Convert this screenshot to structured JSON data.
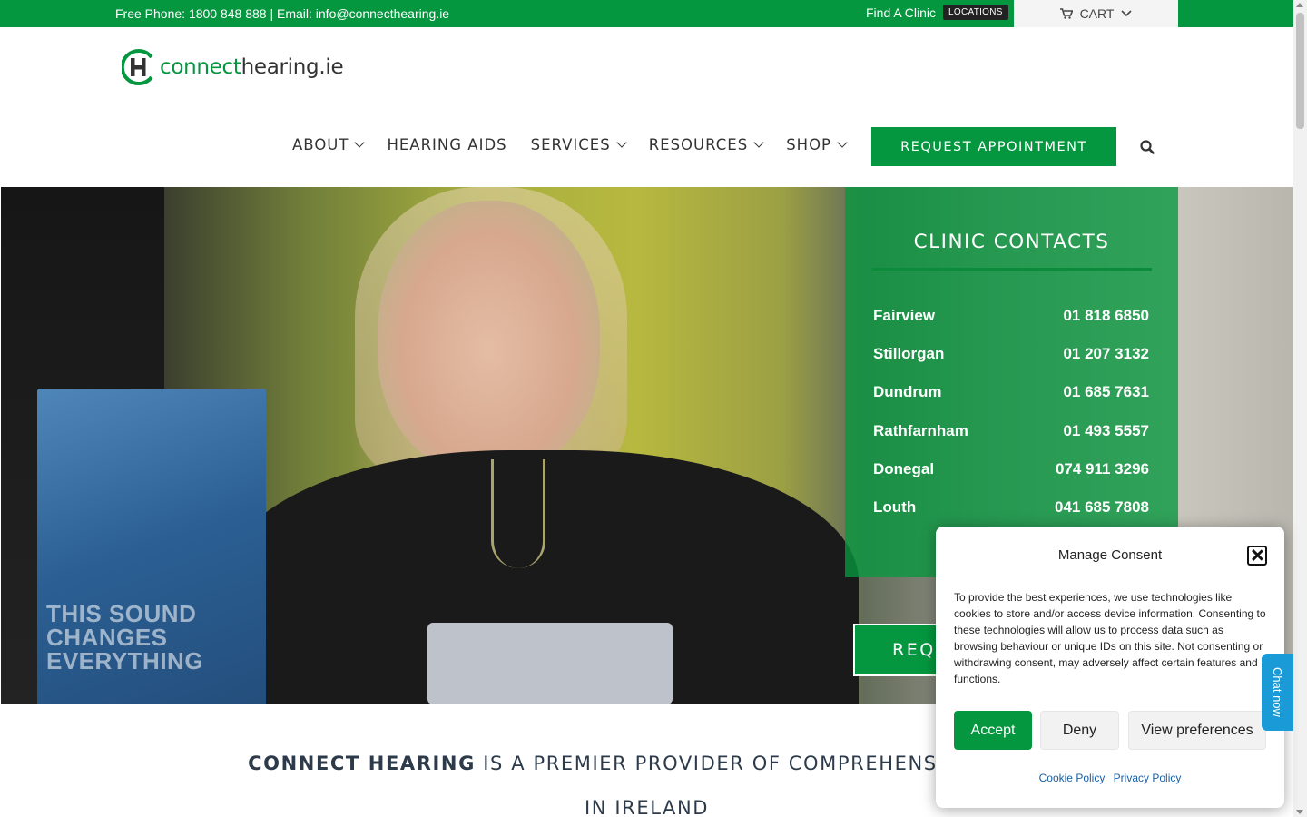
{
  "topbar": {
    "contact": "Free Phone: 1800 848 888  |  Email: info@connecthearing.ie",
    "find_clinic": "Find A Clinic",
    "locations_badge": "LOCATIONS",
    "cart_label": "CART"
  },
  "logo": {
    "part1": "connect",
    "part2": "hearing.ie"
  },
  "nav": {
    "items": [
      "ABOUT",
      "HEARING AIDS",
      "SERVICES",
      "RESOURCES",
      "SHOP"
    ],
    "cta": "REQUEST APPOINTMENT"
  },
  "clinic_contacts": {
    "title": "CLINIC CONTACTS",
    "rows": [
      {
        "name": "Fairview",
        "phone": "01 818 6850"
      },
      {
        "name": "Stillorgan",
        "phone": "01 207 3132"
      },
      {
        "name": "Dundrum",
        "phone": "01 685 7631"
      },
      {
        "name": "Rathfarnham",
        "phone": "01 493 5557"
      },
      {
        "name": "Donegal",
        "phone": "074 911 3296"
      },
      {
        "name": "Louth",
        "phone": "041 685 7808"
      }
    ]
  },
  "hero": {
    "button_partial": "REQ",
    "sign_text_1": "THIS SOUND",
    "sign_text_2": "CHANGES",
    "sign_text_3": "EVERYTHING"
  },
  "headline": {
    "brand": "CONNECT HEARING",
    "rest": " IS A PREMIER PROVIDER OF COMPREHENSIVE HEARI",
    "line2": "IN IRELAND"
  },
  "consent": {
    "title": "Manage Consent",
    "text": "To provide the best experiences, we use technologies like cookies to store and/or access device information. Consenting to these technologies will allow us to process data such as browsing behaviour or unique IDs on this site. Not consenting or withdrawing consent, may adversely affect certain features and functions.",
    "accept": "Accept",
    "deny": "Deny",
    "preferences": "View preferences",
    "cookie_policy": "Cookie Policy",
    "privacy_policy": "Privacy Policy"
  },
  "chat": {
    "label": "Chat now"
  },
  "colors": {
    "brand_green": "#04973f",
    "chat_blue": "#1a9ad6"
  }
}
